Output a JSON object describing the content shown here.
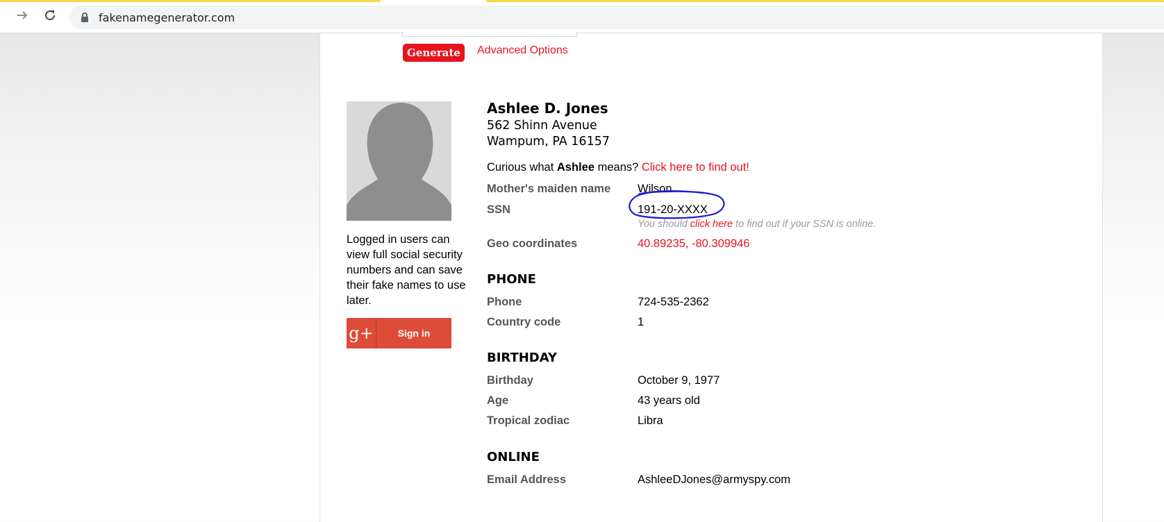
{
  "browser": {
    "url": "fakenamegenerator.com"
  },
  "toolbar": {
    "generate_label": "Generate",
    "advanced_label": "Advanced Options"
  },
  "sidebar": {
    "login_note": "Logged in users can view full social security numbers and can save their fake names to use later.",
    "signin_label": "Sign in",
    "gplus_glyph": "g+"
  },
  "identity": {
    "name": "Ashlee D. Jones",
    "address_line1": "562 Shinn Avenue",
    "address_line2": "Wampum, PA 16157",
    "curious_prefix": "Curious what",
    "curious_name": "Ashlee",
    "curious_mid": "means?",
    "curious_link": "Click here to find out!"
  },
  "details": {
    "maiden_label": "Mother's maiden name",
    "maiden_value": "Wilson",
    "ssn_label": "SSN",
    "ssn_value": "191-20-XXXX",
    "ssn_note_prefix": "You should",
    "ssn_note_link": "click here",
    "ssn_note_suffix": "to find out if your SSN is online.",
    "geo_label": "Geo coordinates",
    "geo_value": "40.89235, -80.309946"
  },
  "phone": {
    "heading": "PHONE",
    "phone_label": "Phone",
    "phone_value": "724-535-2362",
    "country_label": "Country code",
    "country_value": "1"
  },
  "birthday": {
    "heading": "BIRTHDAY",
    "birthday_label": "Birthday",
    "birthday_value": "October 9, 1977",
    "age_label": "Age",
    "age_value": "43 years old",
    "zodiac_label": "Tropical zodiac",
    "zodiac_value": "Libra"
  },
  "online": {
    "heading": "ONLINE",
    "email_label": "Email Address",
    "email_value": "AshleeDJones@armyspy.com"
  },
  "colors": {
    "accent_red": "#e6141d",
    "annotation_blue": "#1a1ad6",
    "gplus_red": "#dd4b39"
  }
}
